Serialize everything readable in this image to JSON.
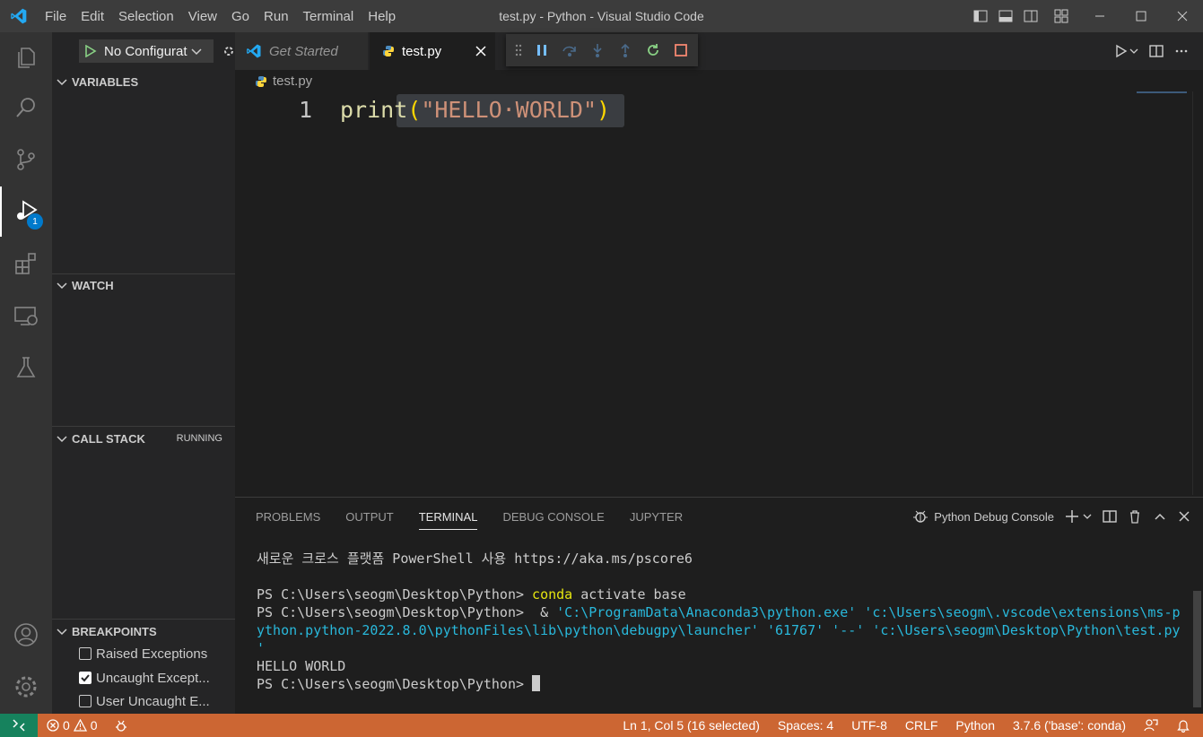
{
  "window": {
    "title": "test.py - Python - Visual Studio Code",
    "menu": [
      "File",
      "Edit",
      "Selection",
      "View",
      "Go",
      "Run",
      "Terminal",
      "Help"
    ]
  },
  "activity_bar": {
    "debug_badge": "1"
  },
  "sidebar": {
    "config_select": "No Configurat",
    "sections": {
      "variables": "VARIABLES",
      "watch": "WATCH",
      "call_stack": "CALL STACK",
      "call_stack_status": "RUNNING",
      "breakpoints": "BREAKPOINTS"
    },
    "breakpoints": [
      {
        "label": "Raised Exceptions",
        "checked": false
      },
      {
        "label": "Uncaught Except...",
        "checked": true
      },
      {
        "label": "User Uncaught E...",
        "checked": false
      }
    ]
  },
  "tabs": [
    {
      "label": "Get Started",
      "active": false
    },
    {
      "label": "test.py",
      "active": true
    }
  ],
  "editor": {
    "breadcrumb": "test.py",
    "line_number": "1",
    "code": {
      "fn": "print",
      "open": "(",
      "str": "\"HELLO·WORLD\"",
      "close": ")"
    }
  },
  "panel": {
    "tabs": [
      "PROBLEMS",
      "OUTPUT",
      "TERMINAL",
      "DEBUG CONSOLE",
      "JUPYTER"
    ],
    "active_tab": "TERMINAL",
    "terminal_name": "Python Debug Console",
    "terminal": {
      "line1": "새로운 크로스 플랫폼 PowerShell 사용 https://aka.ms/pscore6",
      "prompt": "PS C:\\Users\\seogm\\Desktop\\Python> ",
      "cmd1": "conda",
      "cmd1_rest": " activate base",
      "cmd2_amp": " & ",
      "cmd2_a": "'C:\\ProgramData\\Anaconda3\\python.exe' 'c:\\Users\\seogm\\.vscode\\extensions\\ms-p",
      "cmd2_b": "ython.python-2022.8.0\\pythonFiles\\lib\\python\\debugpy\\launcher' '61767' '--' 'c:\\Users\\seogm\\Desktop\\Python\\test.py",
      "cmd2_c": "'",
      "output": "HELLO WORLD"
    }
  },
  "status_bar": {
    "errors": "0",
    "warnings": "0",
    "position": "Ln 1, Col 5 (16 selected)",
    "spaces": "Spaces: 4",
    "encoding": "UTF-8",
    "eol": "CRLF",
    "language": "Python",
    "interpreter": "3.7.6 ('base': conda)"
  },
  "colors": {
    "status_bar_debug": "#cc6633",
    "remote": "#16825d",
    "accent": "#007acc"
  }
}
